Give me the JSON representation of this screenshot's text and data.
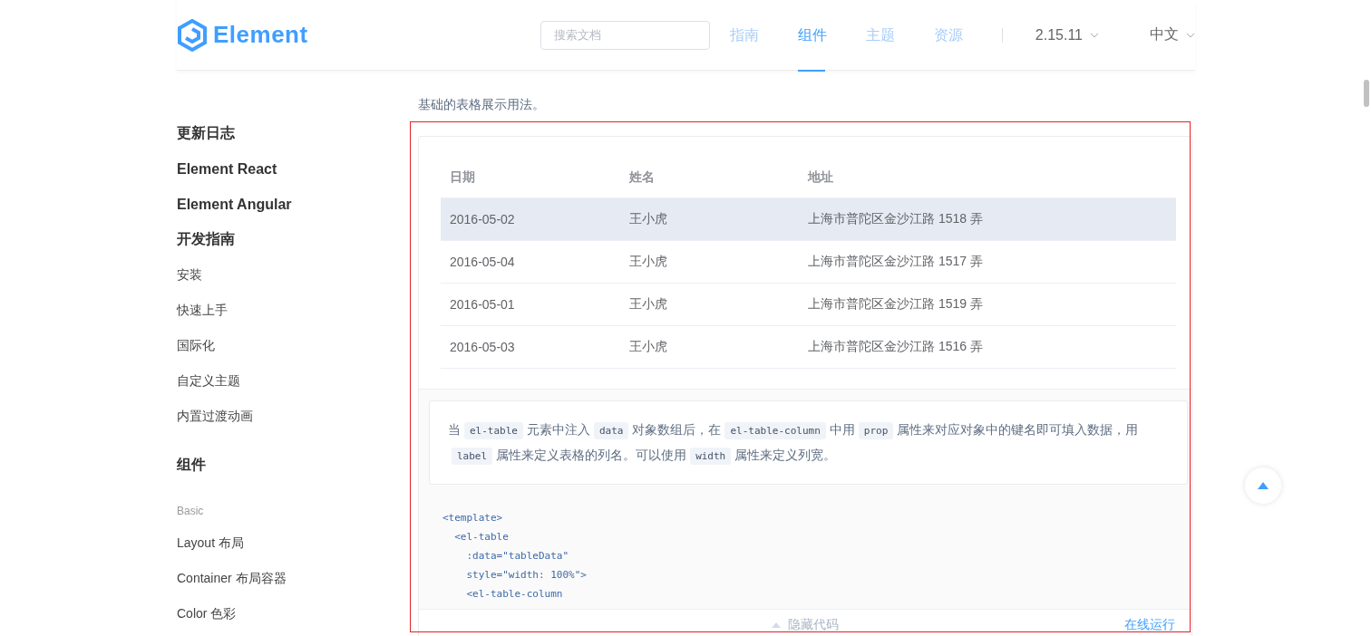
{
  "header": {
    "logo": "Element",
    "search": {
      "placeholder": "搜索文档"
    },
    "nav": [
      {
        "label": "指南",
        "selected": false
      },
      {
        "label": "组件",
        "selected": true
      },
      {
        "label": "主题",
        "selected": false
      },
      {
        "label": "资源",
        "selected": false
      }
    ],
    "version": "2.15.11",
    "language": "中文"
  },
  "sidebar": {
    "items": [
      {
        "kind": "group",
        "label": "更新日志"
      },
      {
        "kind": "group",
        "label": "Element React"
      },
      {
        "kind": "group",
        "label": "Element Angular"
      },
      {
        "kind": "group",
        "label": "开发指南"
      },
      {
        "kind": "link",
        "label": "安装"
      },
      {
        "kind": "link",
        "label": "快速上手"
      },
      {
        "kind": "link",
        "label": "国际化"
      },
      {
        "kind": "link",
        "label": "自定义主题"
      },
      {
        "kind": "link",
        "label": "内置过渡动画"
      },
      {
        "kind": "group",
        "label": "组件"
      },
      {
        "kind": "category",
        "label": "Basic"
      },
      {
        "kind": "link",
        "label": "Layout 布局"
      },
      {
        "kind": "link",
        "label": "Container 布局容器"
      },
      {
        "kind": "link",
        "label": "Color 色彩"
      }
    ]
  },
  "page": {
    "intro": "基础的表格展示用法。",
    "table": {
      "columns": [
        "日期",
        "姓名",
        "地址"
      ],
      "rows": [
        {
          "hovered": true,
          "cells": [
            "2016-05-02",
            "王小虎",
            "上海市普陀区金沙江路 1518 弄"
          ]
        },
        {
          "hovered": false,
          "cells": [
            "2016-05-04",
            "王小虎",
            "上海市普陀区金沙江路 1517 弄"
          ]
        },
        {
          "hovered": false,
          "cells": [
            "2016-05-01",
            "王小虎",
            "上海市普陀区金沙江路 1519 弄"
          ]
        },
        {
          "hovered": false,
          "cells": [
            "2016-05-03",
            "王小虎",
            "上海市普陀区金沙江路 1516 弄"
          ]
        }
      ]
    },
    "explanation": [
      {
        "kind": "text",
        "text": "当"
      },
      {
        "kind": "code",
        "text": "el-table"
      },
      {
        "kind": "text",
        "text": "元素中注入"
      },
      {
        "kind": "code",
        "text": "data"
      },
      {
        "kind": "text",
        "text": "对象数组后，在"
      },
      {
        "kind": "code",
        "text": "el-table-column"
      },
      {
        "kind": "text",
        "text": "中用"
      },
      {
        "kind": "code",
        "text": "prop"
      },
      {
        "kind": "text",
        "text": "属性来对应对象中的键名即可填入数据，用"
      },
      {
        "kind": "code",
        "text": "label"
      },
      {
        "kind": "text",
        "text": "属性来定义表格的列名。可以使用"
      },
      {
        "kind": "code",
        "text": "width"
      },
      {
        "kind": "text",
        "text": "属性来定义列宽。"
      }
    ],
    "code_lines": [
      "<template>",
      "  <el-table",
      "    :data=\"tableData\"",
      "    style=\"width: 100%\">",
      "    <el-table-column"
    ],
    "hide_code": "隐藏代码",
    "run_online": "在线运行"
  }
}
